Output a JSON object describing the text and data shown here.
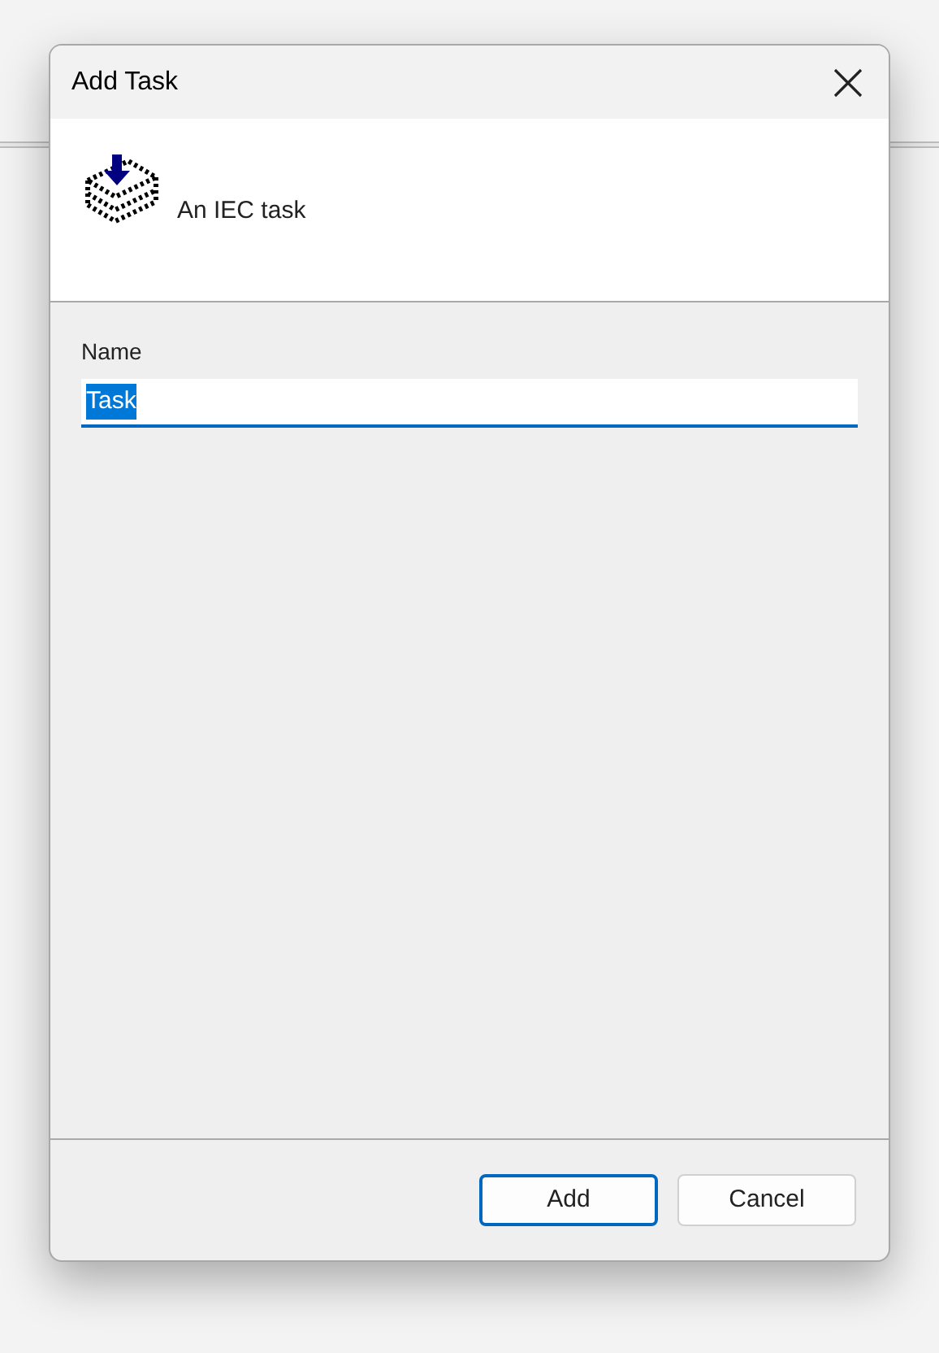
{
  "window": {
    "title": "Add Task"
  },
  "header": {
    "description": "An IEC task"
  },
  "field": {
    "label": "Name",
    "value": "Task",
    "text_selected": true
  },
  "buttons": [
    {
      "label": "Add",
      "default": true
    },
    {
      "label": "Cancel",
      "default": false
    }
  ]
}
